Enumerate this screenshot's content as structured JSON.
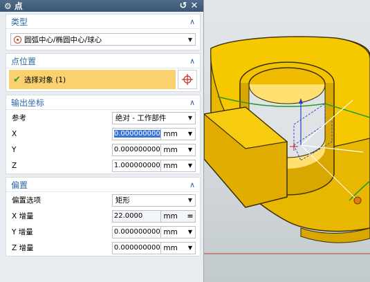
{
  "dialog": {
    "title": "点",
    "reset_icon": "reset-icon",
    "close_icon": "close-icon"
  },
  "type_group": {
    "header": "类型",
    "selected": "圆弧中心/椭圆中心/球心"
  },
  "point_location": {
    "header": "点位置",
    "select_label": "选择对象 (1)"
  },
  "output_coords": {
    "header": "输出坐标",
    "reference_label": "参考",
    "reference_value": "绝对 - 工作部件",
    "x_label": "X",
    "x_value": "0.000000000",
    "y_label": "Y",
    "y_value": "0.000000000",
    "z_label": "Z",
    "z_value": "1.000000000",
    "unit": "mm"
  },
  "offset": {
    "header": "偏置",
    "option_label": "偏置选项",
    "option_value": "矩形",
    "dx_label": "X 增量",
    "dx_value": "22.0000",
    "dy_label": "Y 增量",
    "dy_value": "0.000000000",
    "dz_label": "Z 增量",
    "dz_value": "0.000000000",
    "unit": "mm"
  },
  "colors": {
    "title_bar": "#3f5b79",
    "section_header": "#2d67a8",
    "selection_highlight": "#fbd16f",
    "part_color": "#f2c300"
  }
}
